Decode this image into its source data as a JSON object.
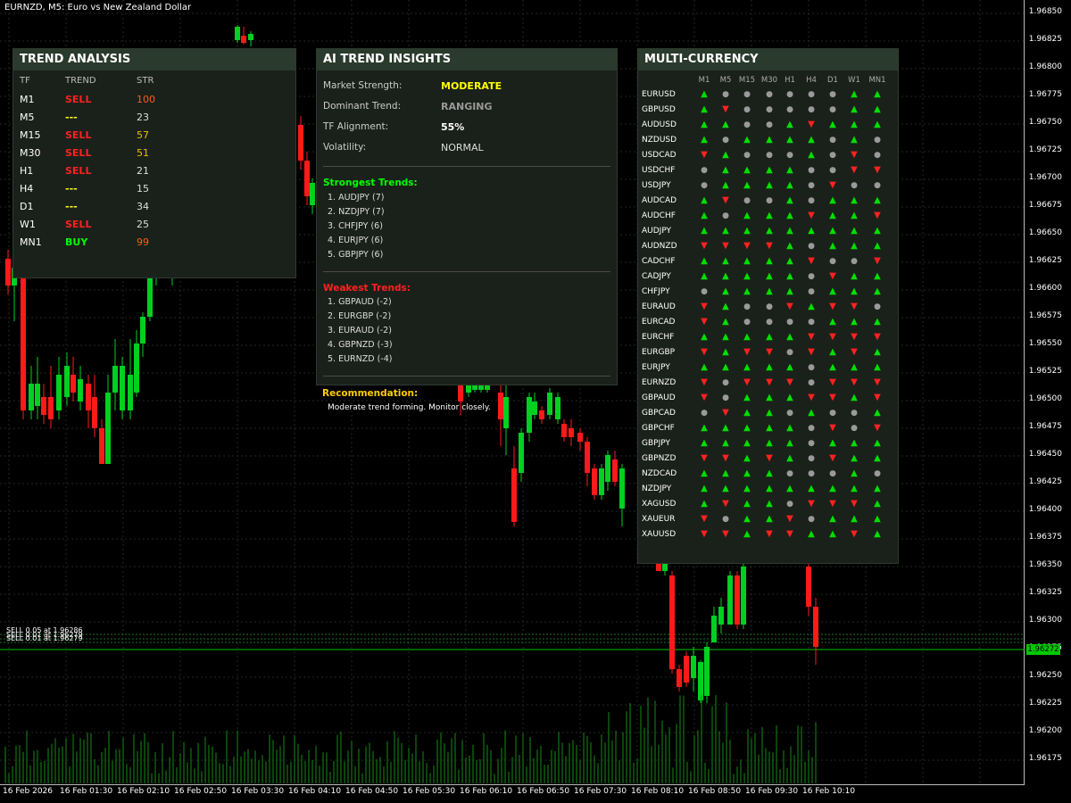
{
  "window": {
    "title": "EURNZD, M5:  Euro vs New Zealand Dollar"
  },
  "price_axis": [
    "1.96850",
    "1.96825",
    "1.96800",
    "1.96775",
    "1.96750",
    "1.96725",
    "1.96700",
    "1.96675",
    "1.96650",
    "1.96625",
    "1.96600",
    "1.96575",
    "1.96550",
    "1.96525",
    "1.96500",
    "1.96475",
    "1.96450",
    "1.96425",
    "1.96400",
    "1.96375",
    "1.96350",
    "1.96325",
    "1.96300",
    "1.96275",
    "1.96250",
    "1.96225",
    "1.96200",
    "1.96175"
  ],
  "current_price": "1.96272",
  "time_axis": [
    "16 Feb 2026",
    "16 Feb 01:30",
    "16 Feb 02:10",
    "16 Feb 02:50",
    "16 Feb 03:30",
    "16 Feb 04:10",
    "16 Feb 04:50",
    "16 Feb 05:30",
    "16 Feb 06:10",
    "16 Feb 06:50",
    "16 Feb 07:30",
    "16 Feb 08:10",
    "16 Feb 08:50",
    "16 Feb 09:30",
    "16 Feb 10:10"
  ],
  "orders": [
    "SELL 0.05 at 1.96286",
    "SELL 0.01 at 1.96279",
    "SELL 0.01 at 1.96279"
  ],
  "colors": {
    "up": "#00e000",
    "down": "#ff2020",
    "neutral": "#ffff00",
    "accent_green": "#00ff00",
    "accent_red": "#ff2020",
    "panel_bg": "#1a211a",
    "header_bg": "#2a3a2c"
  },
  "trend_analysis": {
    "title": "TREND ANALYSIS",
    "headers": {
      "tf": "TF",
      "trend": "TREND",
      "str": "STR"
    },
    "rows": [
      {
        "tf": "M1",
        "trend": "SELL",
        "str": "100"
      },
      {
        "tf": "M5",
        "trend": "---",
        "str": "23"
      },
      {
        "tf": "M15",
        "trend": "SELL",
        "str": "57"
      },
      {
        "tf": "M30",
        "trend": "SELL",
        "str": "51"
      },
      {
        "tf": "H1",
        "trend": "SELL",
        "str": "21"
      },
      {
        "tf": "H4",
        "trend": "---",
        "str": "15"
      },
      {
        "tf": "D1",
        "trend": "---",
        "str": "34"
      },
      {
        "tf": "W1",
        "trend": "SELL",
        "str": "25"
      },
      {
        "tf": "MN1",
        "trend": "BUY",
        "str": "99"
      }
    ]
  },
  "ai_insights": {
    "title": "AI TREND INSIGHTS",
    "market_strength_label": "Market Strength:",
    "market_strength": "MODERATE",
    "dominant_trend_label": "Dominant Trend:",
    "dominant_trend": "RANGING",
    "tf_alignment_label": "TF Alignment:",
    "tf_alignment": "55%",
    "volatility_label": "Volatility:",
    "volatility": "NORMAL",
    "strongest_title": "Strongest Trends:",
    "strongest": [
      "1. AUDJPY (7)",
      "2. NZDJPY (7)",
      "3. CHFJPY (6)",
      "4. EURJPY (6)",
      "5. GBPJPY (6)"
    ],
    "weakest_title": "Weakest Trends:",
    "weakest": [
      "1. GBPAUD (-2)",
      "2. EURGBP (-2)",
      "3. EURAUD (-2)",
      "4. GBPNZD (-3)",
      "5. EURNZD (-4)"
    ],
    "recommendation_title": "Recommendation:",
    "recommendation": "Moderate trend forming. Monitor closely."
  },
  "multi_currency": {
    "title": "MULTI-CURRENCY",
    "timeframes": [
      "M1",
      "M5",
      "M15",
      "M30",
      "H1",
      "H4",
      "D1",
      "W1",
      "MN1"
    ],
    "rows": [
      {
        "symbol": "EURUSD",
        "signals": "u n n n n n n u u"
      },
      {
        "symbol": "GBPUSD",
        "signals": "u d n n n n n u u"
      },
      {
        "symbol": "AUDUSD",
        "signals": "u u n n u d u u u"
      },
      {
        "symbol": "NZDUSD",
        "signals": "u n u u u u n u n"
      },
      {
        "symbol": "USDCAD",
        "signals": "d u n n n u n d n"
      },
      {
        "symbol": "USDCHF",
        "signals": "n u u u u n n d d"
      },
      {
        "symbol": "USDJPY",
        "signals": "n u u u u n d n n"
      },
      {
        "symbol": "AUDCAD",
        "signals": "u d n n u n u u u"
      },
      {
        "symbol": "AUDCHF",
        "signals": "u n u u u d u u d"
      },
      {
        "symbol": "AUDJPY",
        "signals": "u u u u u u u u u"
      },
      {
        "symbol": "AUDNZD",
        "signals": "d d d d u n u u u"
      },
      {
        "symbol": "CADCHF",
        "signals": "u u u u u d n n d"
      },
      {
        "symbol": "CADJPY",
        "signals": "u u u u u n d u u"
      },
      {
        "symbol": "CHFJPY",
        "signals": "n u u u u n u u u"
      },
      {
        "symbol": "EURAUD",
        "signals": "d u n n d u d d n"
      },
      {
        "symbol": "EURCAD",
        "signals": "d u n n n n u u u"
      },
      {
        "symbol": "EURCHF",
        "signals": "u u u u u d d d d"
      },
      {
        "symbol": "EURGBP",
        "signals": "d u d d n d u d u"
      },
      {
        "symbol": "EURJPY",
        "signals": "u u u u u n u u u"
      },
      {
        "symbol": "EURNZD",
        "signals": "d n d d d n d d d"
      },
      {
        "symbol": "GBPAUD",
        "signals": "d n u u u d d u d"
      },
      {
        "symbol": "GBPCAD",
        "signals": "n d u u n u n n u"
      },
      {
        "symbol": "GBPCHF",
        "signals": "u u u u u n d n d"
      },
      {
        "symbol": "GBPJPY",
        "signals": "u u u u u n u u u"
      },
      {
        "symbol": "GBPNZD",
        "signals": "d d u d u n d u u"
      },
      {
        "symbol": "NZDCAD",
        "signals": "u u u u n n n u n"
      },
      {
        "symbol": "NZDJPY",
        "signals": "u u u u u u u u u"
      },
      {
        "symbol": "XAGUSD",
        "signals": "u d u u n d d d u"
      },
      {
        "symbol": "XAUEUR",
        "signals": "d n u u d n u u u"
      },
      {
        "symbol": "XAUUSD",
        "signals": "d d u d d u u d u"
      }
    ]
  }
}
